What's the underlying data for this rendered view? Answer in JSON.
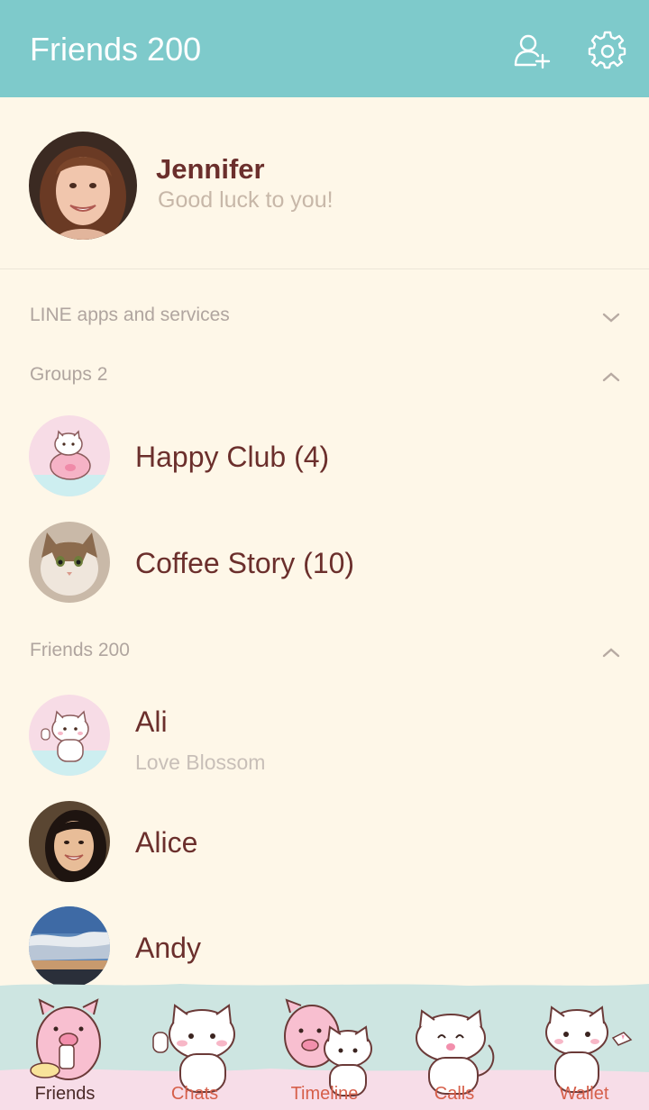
{
  "header": {
    "title": "Friends 200"
  },
  "profile": {
    "name": "Jennifer",
    "status": "Good luck to you!"
  },
  "sections": {
    "services": {
      "label": "LINE apps and services"
    },
    "groups": {
      "label": "Groups 2"
    },
    "friends": {
      "label": "Friends 200"
    }
  },
  "groups": [
    {
      "name": "Happy Club (4)"
    },
    {
      "name": "Coffee Story (10)"
    }
  ],
  "friends": [
    {
      "name": "Ali",
      "status": "Love Blossom"
    },
    {
      "name": "Alice"
    },
    {
      "name": "Andy"
    }
  ],
  "tabs": [
    {
      "label": "Friends",
      "active": true
    },
    {
      "label": "Chats"
    },
    {
      "label": "Timeline"
    },
    {
      "label": "Calls"
    },
    {
      "label": "Wallet"
    }
  ],
  "colors": {
    "header": "#7ecacb",
    "background": "#fef7e8",
    "name_text": "#6b2f2c",
    "tab_label": "#d65f4a"
  }
}
